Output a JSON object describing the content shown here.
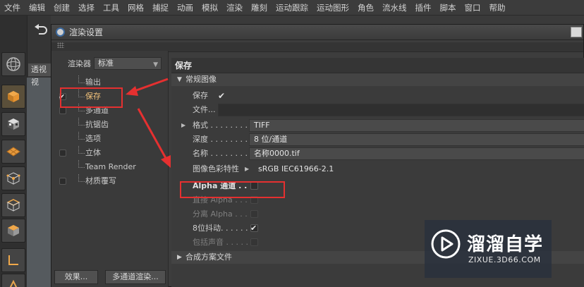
{
  "menu": [
    "文件",
    "编辑",
    "创建",
    "选择",
    "工具",
    "网格",
    "捕捉",
    "动画",
    "模拟",
    "渲染",
    "雕刻",
    "运动跟踪",
    "运动图形",
    "角色",
    "流水线",
    "插件",
    "脚本",
    "窗口",
    "帮助"
  ],
  "viewport_tab": "透视视",
  "dialog": {
    "title": "渲染设置",
    "renderer_label": "渲染器",
    "renderer_value": "标准",
    "tree": [
      {
        "label": "输出",
        "checkbox": false,
        "checked": false,
        "selected": false
      },
      {
        "label": "保存",
        "checkbox": true,
        "checked": true,
        "selected": true
      },
      {
        "label": "多通道",
        "checkbox": true,
        "checked": false,
        "selected": false
      },
      {
        "label": "抗锯齿",
        "checkbox": false,
        "checked": false,
        "selected": false
      },
      {
        "label": "选项",
        "checkbox": false,
        "checked": false,
        "selected": false
      },
      {
        "label": "立体",
        "checkbox": true,
        "checked": false,
        "selected": false
      },
      {
        "label": "Team Render",
        "checkbox": false,
        "checked": false,
        "selected": false
      },
      {
        "label": "材质覆写",
        "checkbox": true,
        "checked": false,
        "selected": false
      }
    ],
    "effects_button": "效果...",
    "multipass_button": "多通道渲染..."
  },
  "save_panel": {
    "header": "保存",
    "section_general": "常规图像",
    "save_label": "保存",
    "file_label": "文件...",
    "file_value": "",
    "format_label": "格式 . . . . . . . . . .",
    "format_value": "TIFF",
    "depth_label": "深度 . . . . . . . . . .",
    "depth_value": "8 位/通道",
    "name_label": "名称 . . . . . . . . . .",
    "name_value": "名称0000.tif",
    "color_profile_label": "图像色彩特性",
    "color_profile_value": "sRGB IEC61966-2.1",
    "alpha_label": "Alpha 通道 . . . .",
    "straight_alpha_label": "直接 Alpha . . . .",
    "separate_alpha_label": "分离 Alpha . . . .",
    "dither_label": "8位抖动. . . . . . . .",
    "include_sound_label": "包括声音 . . . . . .",
    "section_compositing": "合成方案文件",
    "save_checked": true,
    "alpha_checked": false,
    "dither_checked": true
  },
  "watermark": {
    "title": "溜溜自学",
    "url": "ZIXUE.3D66.COM"
  },
  "colors": {
    "annotation_red": "#e53030",
    "selected_text": "#f2c27a"
  }
}
